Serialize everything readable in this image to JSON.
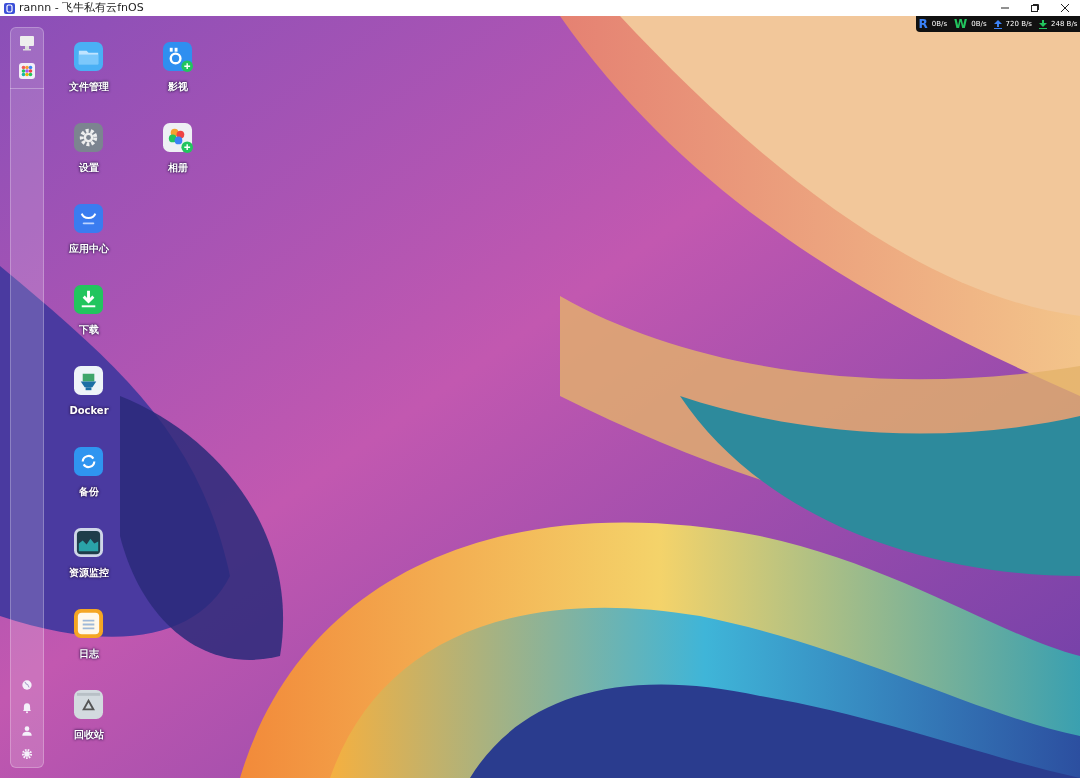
{
  "window": {
    "title": "rannn - 飞牛私有云fnOS"
  },
  "net_stats": [
    {
      "kind": "letter",
      "label": "R",
      "value": "0B/s",
      "color": "#3b82f6"
    },
    {
      "kind": "letter",
      "label": "W",
      "value": "0B/s",
      "color": "#22c55e"
    },
    {
      "kind": "upload",
      "value": "720 B/s",
      "color": "#3b82f6"
    },
    {
      "kind": "download",
      "value": "248 B/s",
      "color": "#22c55e"
    }
  ],
  "sidebar": {
    "top_items": [
      {
        "kind": "desktop"
      },
      {
        "kind": "apps"
      }
    ],
    "bottom_items": [
      {
        "kind": "network"
      },
      {
        "kind": "bell"
      },
      {
        "kind": "user"
      },
      {
        "kind": "settings"
      }
    ]
  },
  "desktop_apps": [
    {
      "label": "文件管理",
      "kind": "files"
    },
    {
      "label": "设置",
      "kind": "settings"
    },
    {
      "label": "应用中心",
      "kind": "store"
    },
    {
      "label": "下载",
      "kind": "download"
    },
    {
      "label": "Docker",
      "kind": "docker"
    },
    {
      "label": "备份",
      "kind": "backup"
    },
    {
      "label": "资源监控",
      "kind": "monitor"
    },
    {
      "label": "日志",
      "kind": "log"
    },
    {
      "label": "回收站",
      "kind": "trash"
    },
    {
      "label": "影视",
      "kind": "video"
    },
    {
      "label": "相册",
      "kind": "photos"
    }
  ]
}
